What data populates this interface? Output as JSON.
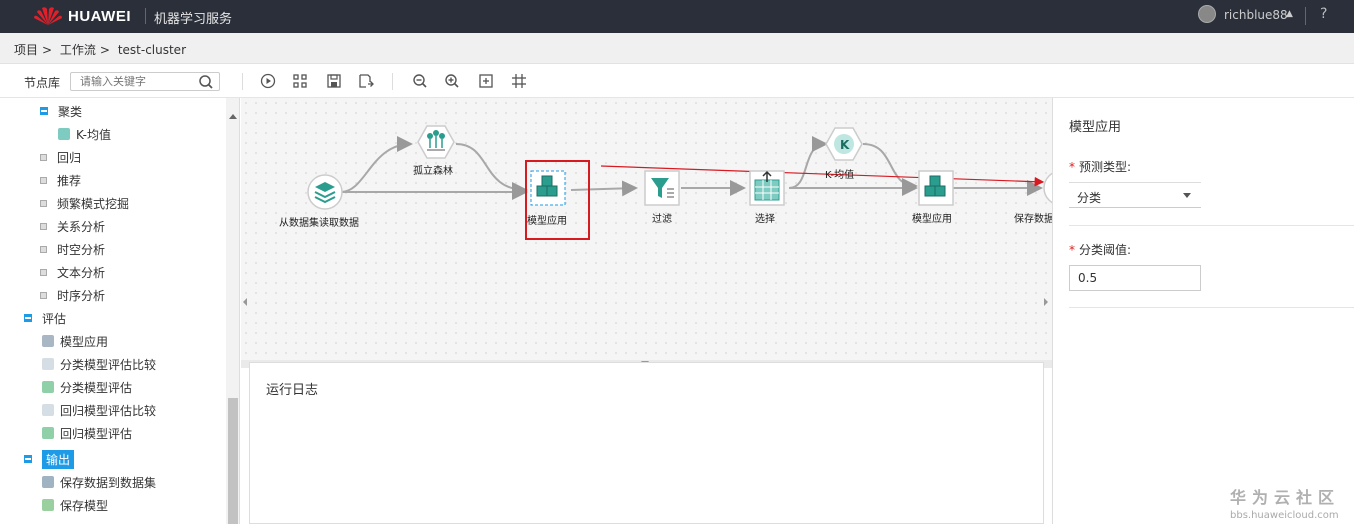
{
  "header": {
    "brand": "HUAWEI",
    "app_title": "机器学习服务",
    "user": "richblue88",
    "help": "?"
  },
  "breadcrumb": [
    "项目",
    "工作流",
    "test-cluster"
  ],
  "breadcrumb_sep": ">",
  "toolbar": {
    "library_label": "节点库",
    "search_placeholder": "请输入关键字"
  },
  "sidebar": {
    "items": [
      {
        "label": "聚类",
        "type": "expanded"
      },
      {
        "label": "K-均值",
        "type": "leaf"
      },
      {
        "label": "回归",
        "type": "collapsed"
      },
      {
        "label": "推荐",
        "type": "collapsed"
      },
      {
        "label": "频繁模式挖掘",
        "type": "collapsed"
      },
      {
        "label": "关系分析",
        "type": "collapsed"
      },
      {
        "label": "时空分析",
        "type": "collapsed"
      },
      {
        "label": "文本分析",
        "type": "collapsed"
      },
      {
        "label": "时序分析",
        "type": "collapsed"
      },
      {
        "label": "评估",
        "type": "expanded"
      },
      {
        "label": "模型应用",
        "type": "leaf"
      },
      {
        "label": "分类模型评估比较",
        "type": "leaf"
      },
      {
        "label": "分类模型评估",
        "type": "leaf"
      },
      {
        "label": "回归模型评估比较",
        "type": "leaf"
      },
      {
        "label": "回归模型评估",
        "type": "leaf"
      },
      {
        "label": "输出",
        "type": "expanded-selected"
      },
      {
        "label": "保存数据到数据集",
        "type": "leaf"
      },
      {
        "label": "保存模型",
        "type": "leaf"
      }
    ]
  },
  "workflow": {
    "nodes": [
      {
        "id": "read",
        "label": "从数据集读取数据"
      },
      {
        "id": "iforest",
        "label": "孤立森林"
      },
      {
        "id": "apply1",
        "label": "模型应用"
      },
      {
        "id": "filter",
        "label": "过滤"
      },
      {
        "id": "select",
        "label": "选择"
      },
      {
        "id": "kmeans",
        "label": "K-均值"
      },
      {
        "id": "apply2",
        "label": "模型应用"
      },
      {
        "id": "save",
        "label": "保存数据"
      }
    ]
  },
  "log": {
    "title": "运行日志"
  },
  "properties": {
    "title": "模型应用",
    "predict_type_label": "预测类型:",
    "predict_type_value": "分类",
    "threshold_label": "分类阈值:",
    "threshold_value": "0.5",
    "required_mark": "*"
  },
  "watermark": {
    "cn": "华为云社区",
    "url": "bbs.huaweicloud.com"
  },
  "colors": {
    "topbar": "#2a2f3a",
    "accent": "#1e9be6",
    "highlight": "#d71920",
    "node_teal": "#2a9d8f"
  }
}
